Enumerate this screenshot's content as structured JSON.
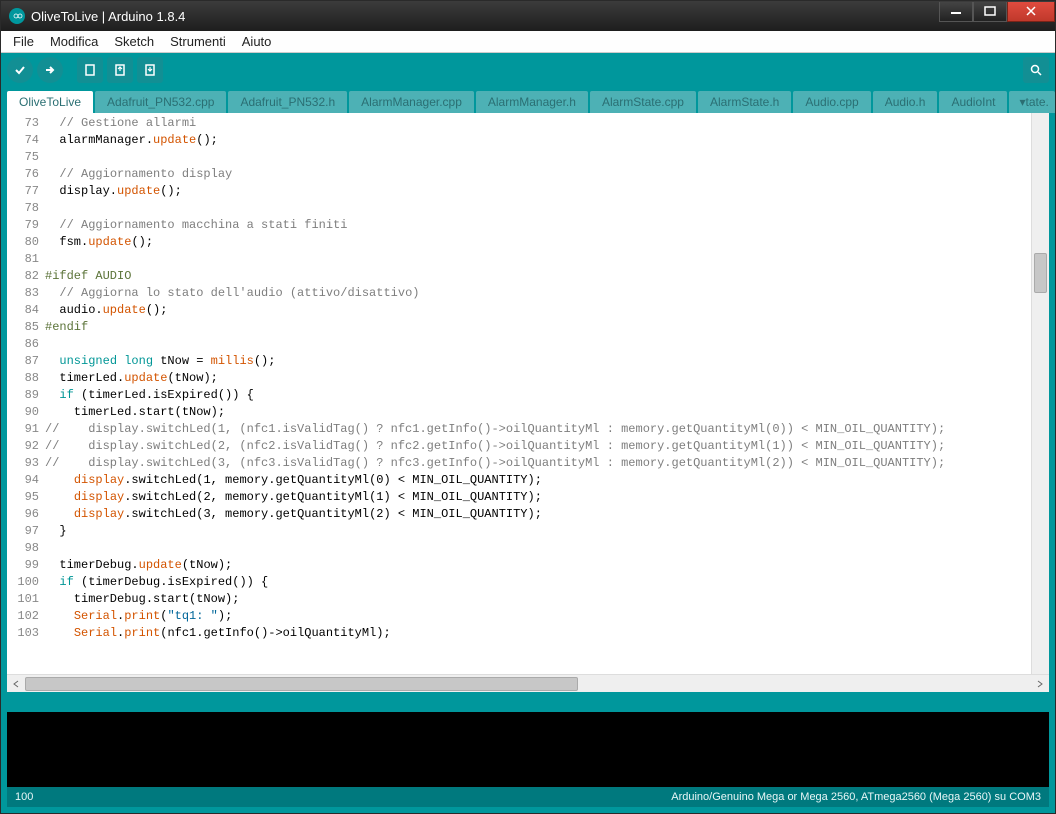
{
  "window": {
    "title": "OliveToLive | Arduino 1.8.4"
  },
  "menu": {
    "file": "File",
    "edit": "Modifica",
    "sketch": "Sketch",
    "tools": "Strumenti",
    "help": "Aiuto"
  },
  "tabs": [
    "OliveToLive",
    "Adafruit_PN532.cpp",
    "Adafruit_PN532.h",
    "AlarmManager.cpp",
    "AlarmManager.h",
    "AlarmState.cpp",
    "AlarmState.h",
    "Audio.cpp",
    "Audio.h",
    "AudioInt"
  ],
  "tabs_more": "tate.",
  "active_tab": 0,
  "status": {
    "line": "100",
    "board": "Arduino/Genuino Mega or Mega 2560, ATmega2560 (Mega 2560) su COM3"
  },
  "code_lines": [
    {
      "n": 73,
      "h": "  <span class='c'>// Gestione allarmi</span>"
    },
    {
      "n": 74,
      "h": "  alarmManager.<span class='fn'>update</span>();"
    },
    {
      "n": 75,
      "h": ""
    },
    {
      "n": 76,
      "h": "  <span class='c'>// Aggiornamento display</span>"
    },
    {
      "n": 77,
      "h": "  display.<span class='fn'>update</span>();"
    },
    {
      "n": 78,
      "h": ""
    },
    {
      "n": 79,
      "h": "  <span class='c'>// Aggiornamento macchina a stati finiti</span>"
    },
    {
      "n": 80,
      "h": "  fsm.<span class='fn'>update</span>();"
    },
    {
      "n": 81,
      "h": ""
    },
    {
      "n": 82,
      "h": "<span class='pp'>#ifdef AUDIO</span>"
    },
    {
      "n": 83,
      "h": "  <span class='c'>// Aggiorna lo stato dell'audio (attivo/disattivo)</span>"
    },
    {
      "n": 84,
      "h": "  audio.<span class='fn'>update</span>();"
    },
    {
      "n": 85,
      "h": "<span class='pp'>#endif</span>"
    },
    {
      "n": 86,
      "h": ""
    },
    {
      "n": 87,
      "h": "  <span class='kw'>unsigned</span> <span class='kw'>long</span> tNow = <span class='fn'>millis</span>();"
    },
    {
      "n": 88,
      "h": "  timerLed.<span class='fn'>update</span>(tNow);"
    },
    {
      "n": 89,
      "h": "  <span class='kw'>if</span> (timerLed.isExpired()) {"
    },
    {
      "n": 90,
      "h": "    timerLed.start(tNow);"
    },
    {
      "n": 91,
      "h": "<span class='c'>//    display.switchLed(1, (nfc1.isValidTag() ? nfc1.getInfo()->oilQuantityMl : memory.getQuantityMl(0)) < MIN_OIL_QUANTITY);</span>"
    },
    {
      "n": 92,
      "h": "<span class='c'>//    display.switchLed(2, (nfc2.isValidTag() ? nfc2.getInfo()->oilQuantityMl : memory.getQuantityMl(1)) < MIN_OIL_QUANTITY);</span>"
    },
    {
      "n": 93,
      "h": "<span class='c'>//    display.switchLed(3, (nfc3.isValidTag() ? nfc3.getInfo()->oilQuantityMl : memory.getQuantityMl(2)) < MIN_OIL_QUANTITY);</span>"
    },
    {
      "n": 94,
      "h": "    <span class='fn'>display</span>.switchLed(1, memory.getQuantityMl(0) < MIN_OIL_QUANTITY);"
    },
    {
      "n": 95,
      "h": "    <span class='fn'>display</span>.switchLed(2, memory.getQuantityMl(1) < MIN_OIL_QUANTITY);"
    },
    {
      "n": 96,
      "h": "    <span class='fn'>display</span>.switchLed(3, memory.getQuantityMl(2) < MIN_OIL_QUANTITY);"
    },
    {
      "n": 97,
      "h": "  }"
    },
    {
      "n": 98,
      "h": ""
    },
    {
      "n": 99,
      "h": "  timerDebug.<span class='fn'>update</span>(tNow);"
    },
    {
      "n": 100,
      "h": "  <span class='kw'>if</span> (timerDebug.isExpired()) {"
    },
    {
      "n": 101,
      "h": "    timerDebug.start(tNow);"
    },
    {
      "n": 102,
      "h": "    <span class='fn'>Serial</span>.<span class='fn'>print</span>(<span class='str'>\"tq1: \"</span>);"
    },
    {
      "n": 103,
      "h": "    <span class='fn'>Serial</span>.<span class='fn'>print</span>(nfc1.getInfo()->oilQuantityMl);"
    }
  ]
}
